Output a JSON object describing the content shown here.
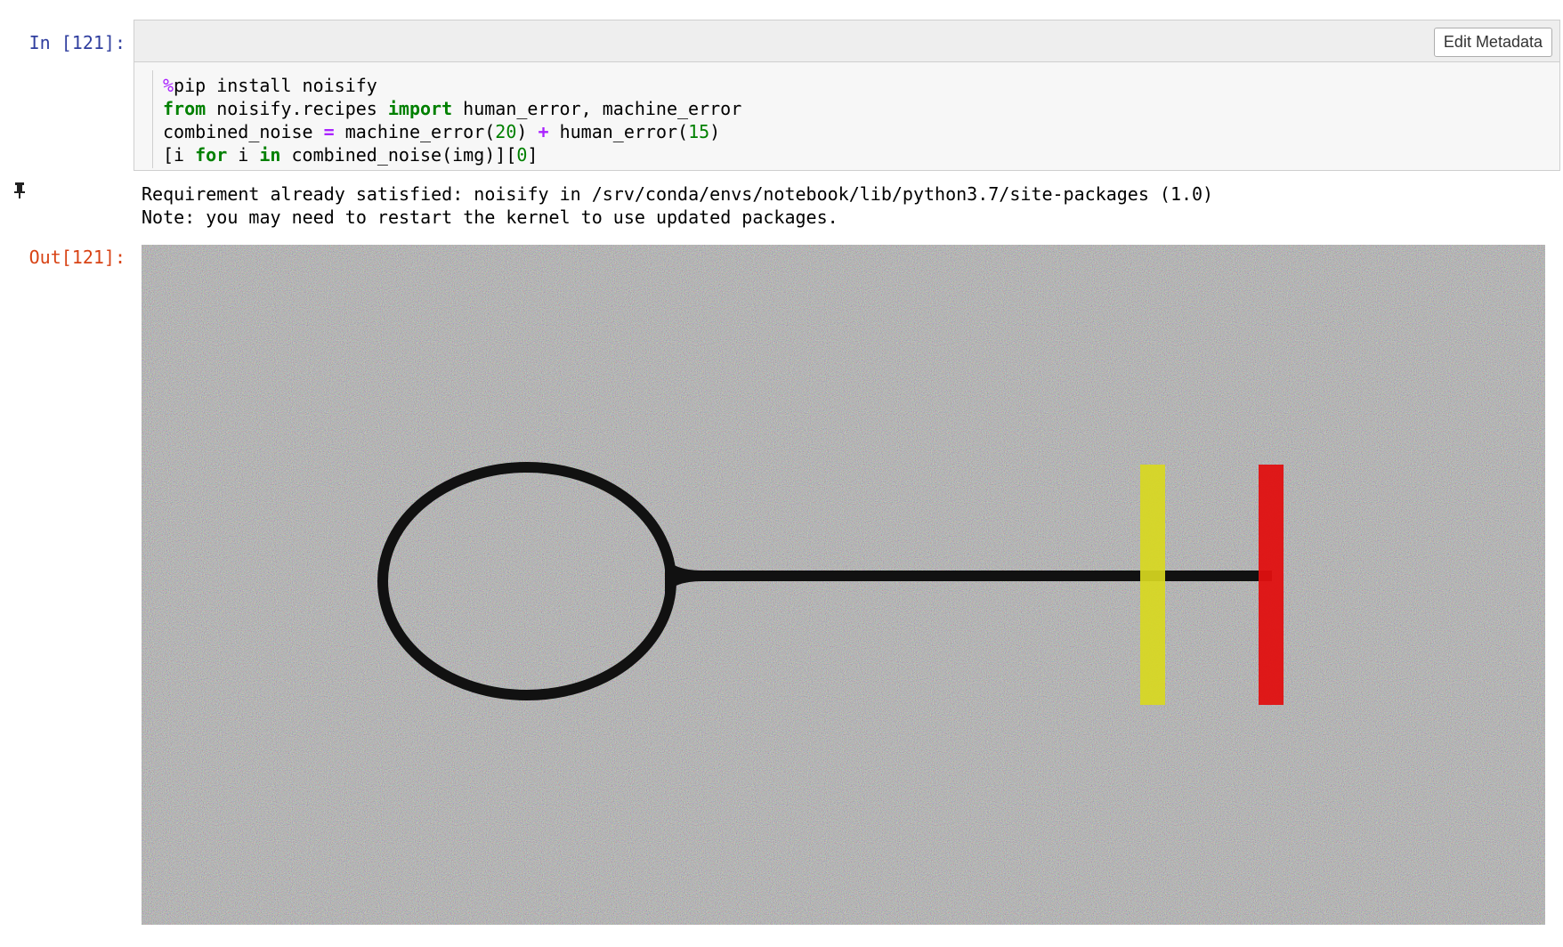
{
  "input_prompt": "In [121]:",
  "output_prompt": "Out[121]:",
  "toolbar": {
    "edit_metadata_label": "Edit Metadata"
  },
  "code": {
    "line1": {
      "magic": "%",
      "rest": "pip install noisify"
    },
    "line2": {
      "kw_from": "from",
      "module": " noisify.recipes ",
      "kw_import": "import",
      "names": " human_error, machine_error"
    },
    "line3": {
      "lhs": "combined_noise ",
      "eq": "=",
      "call1": " machine_error(",
      "arg1": "20",
      "close1": ") ",
      "plus": "+",
      "call2": " human_error(",
      "arg2": "15",
      "close2": ")"
    },
    "line4": {
      "open": "[i ",
      "kw_for": "for",
      "mid": " i ",
      "kw_in": "in",
      "call": " combined_noise(img)][",
      "idx": "0",
      "close": "]"
    }
  },
  "stream_output": [
    "Requirement already satisfied: noisify in /srv/conda/envs/notebook/lib/python3.7/site-packages (1.0)",
    "Note: you may need to restart the kernel to use updated packages."
  ],
  "icons": {
    "pin": "pin-icon"
  },
  "colors": {
    "input_prompt": "#303f9f",
    "output_prompt": "#d84315",
    "keyword": "#008000",
    "operator": "#aa22ff",
    "image_yellow_bar": "#d8d820",
    "image_red_bar": "#e01010",
    "image_shape": "#111111",
    "image_noise_base": "#9c9c9c"
  }
}
